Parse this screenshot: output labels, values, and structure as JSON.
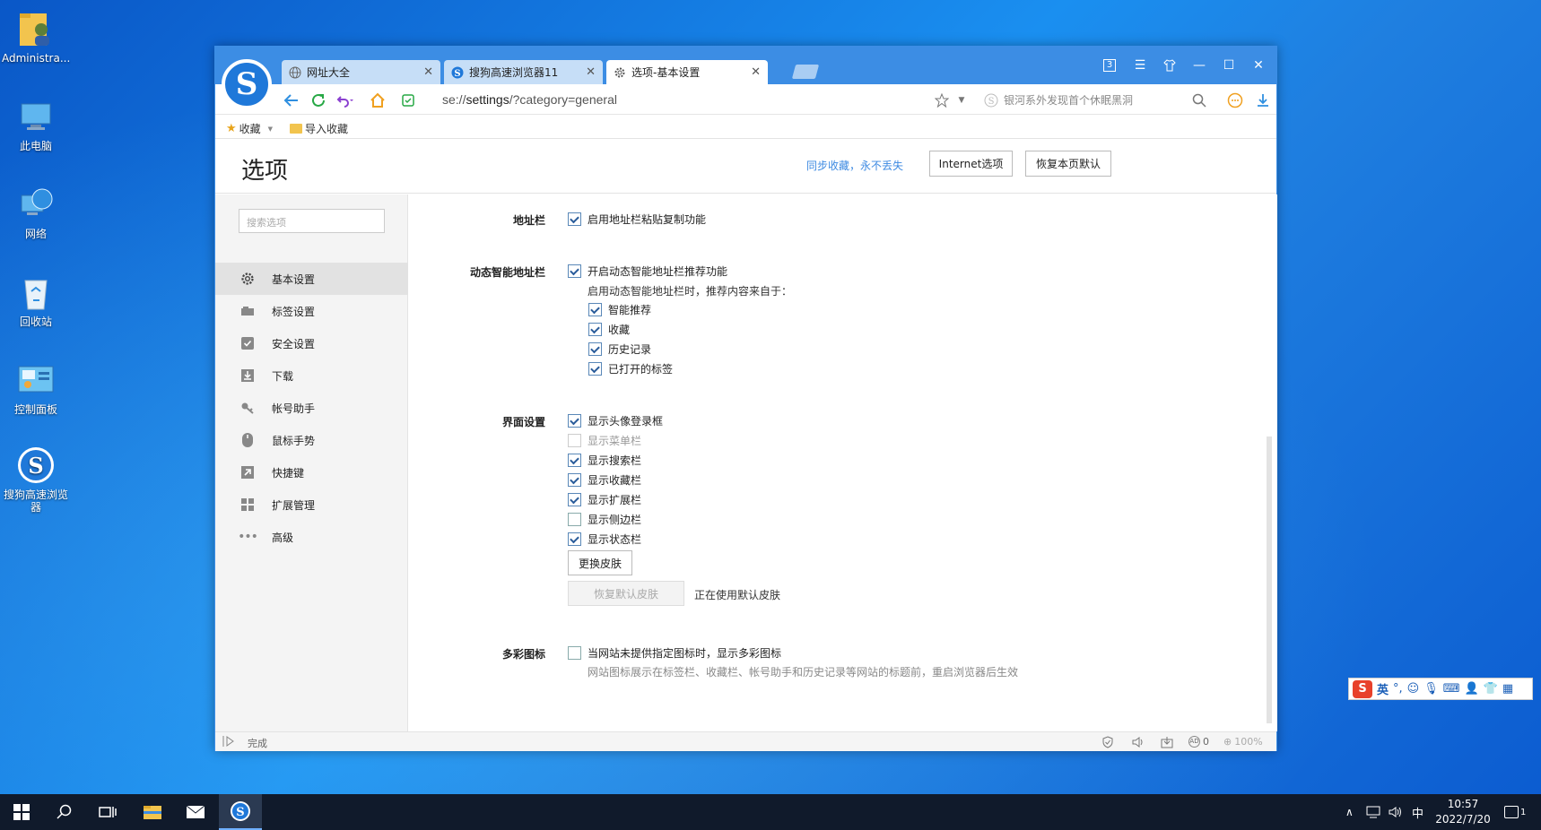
{
  "desktop": {
    "icons": [
      {
        "label": "Administra..."
      },
      {
        "label": "此电脑"
      },
      {
        "label": "网络"
      },
      {
        "label": "回收站"
      },
      {
        "label": "控制面板"
      },
      {
        "label": "搜狗高速浏览器"
      }
    ]
  },
  "browser": {
    "tabs": [
      {
        "label": "网址大全"
      },
      {
        "label": "搜狗高速浏览器11"
      },
      {
        "label": "选项-基本设置"
      }
    ],
    "tab_count": "3",
    "url_prefix": "se://",
    "url_main": "settings",
    "url_suffix": "/?category=general",
    "search_placeholder": "银河系外发现首个休眠黑洞",
    "bookmarks": [
      {
        "label": "收藏"
      },
      {
        "label": "导入收藏"
      }
    ]
  },
  "settings": {
    "title": "选项",
    "sync_link": "同步收藏，永不丢失",
    "internet_options_button": "Internet选项",
    "restore_default_button": "恢复本页默认",
    "search_placeholder": "搜索选项",
    "sidebar": [
      {
        "label": "基本设置",
        "active": true
      },
      {
        "label": "标签设置"
      },
      {
        "label": "安全设置"
      },
      {
        "label": "下载"
      },
      {
        "label": "帐号助手"
      },
      {
        "label": "鼠标手势"
      },
      {
        "label": "快捷键"
      },
      {
        "label": "扩展管理"
      },
      {
        "label": "高级"
      }
    ],
    "address_bar": {
      "label": "地址栏",
      "paste_copy": {
        "label": "启用地址栏粘贴复制功能",
        "checked": true
      }
    },
    "smart_address_bar": {
      "label": "动态智能地址栏",
      "enable": {
        "label": "开启动态智能地址栏推荐功能",
        "checked": true
      },
      "sources_note": "启用动态智能地址栏时，推荐内容来自于：",
      "sources": [
        {
          "label": "智能推荐",
          "checked": true
        },
        {
          "label": "收藏",
          "checked": true
        },
        {
          "label": "历史记录",
          "checked": true
        },
        {
          "label": "已打开的标签",
          "checked": true
        }
      ]
    },
    "interface": {
      "label": "界面设置",
      "options": [
        {
          "label": "显示头像登录框",
          "checked": true
        },
        {
          "label": "显示菜单栏",
          "checked": false,
          "disabled": true
        },
        {
          "label": "显示搜索栏",
          "checked": true
        },
        {
          "label": "显示收藏栏",
          "checked": true
        },
        {
          "label": "显示扩展栏",
          "checked": true
        },
        {
          "label": "显示侧边栏",
          "checked": false
        },
        {
          "label": "显示状态栏",
          "checked": true
        }
      ],
      "change_skin_button": "更换皮肤",
      "restore_skin_button": "恢复默认皮肤",
      "skin_status": "正在使用默认皮肤"
    },
    "colorful_icons": {
      "label": "多彩图标",
      "option": {
        "label": "当网站未提供指定图标时，显示多彩图标",
        "checked": false
      },
      "note": "网站图标展示在标签栏、收藏栏、帐号助手和历史记录等网站的标题前，重启浏览器后生效"
    }
  },
  "statusbar": {
    "text": "完成",
    "ad_count": "0",
    "zoom": "100%"
  },
  "ime": {
    "mode": "英"
  },
  "taskbar": {
    "ime_lang": "中",
    "time": "10:57",
    "date": "2022/7/20",
    "notification_count": "1"
  },
  "colors": {
    "accent": "#3c8de4",
    "link": "#3d8ae2",
    "taskbar": "#101a2b"
  }
}
